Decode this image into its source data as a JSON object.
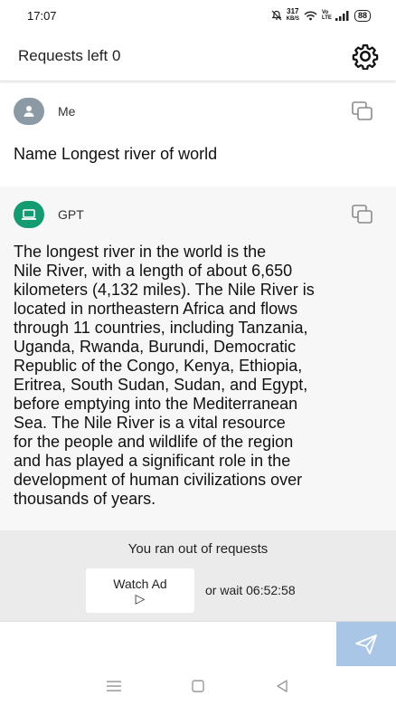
{
  "status_bar": {
    "time": "17:07",
    "speed_value": "317",
    "speed_unit": "KB/S",
    "network_label": "Vo LTE",
    "battery": "88"
  },
  "header": {
    "requests_label": "Requests left 0",
    "settings_icon": "gear-icon"
  },
  "messages": [
    {
      "sender": "Me",
      "avatar_icon": "person-icon",
      "copy_icon": "copy-icon",
      "text": "Name Longest river of world"
    },
    {
      "sender": "GPT",
      "avatar_icon": "laptop-icon",
      "copy_icon": "copy-icon",
      "text": "The longest river in the world is the\nNile River, with a length of about 6,650\nkilometers (4,132 miles). The Nile River is\nlocated in northeastern Africa and flows\nthrough 11 countries, including Tanzania,\nUganda, Rwanda, Burundi, Democratic\nRepublic of the Congo, Kenya, Ethiopia,\nEritrea, South Sudan, Sudan, and Egypt,\nbefore emptying into the Mediterranean\nSea. The Nile River is a vital resource\nfor the people and wildlife of the region\nand has played a significant role in the\ndevelopment of human civilizations over\nthousands of years."
    }
  ],
  "limit_panel": {
    "title": "You ran out of requests",
    "watch_ad_label": "Watch Ad",
    "watch_ad_icon": "▷",
    "wait_text": "or wait 06:52:58"
  },
  "composer": {
    "input_value": "",
    "send_icon": "send-icon"
  },
  "nav": {
    "menu_icon": "menu-icon",
    "home_icon": "square-home-icon",
    "back_icon": "triangle-back-icon"
  },
  "colors": {
    "gpt_avatar": "#159b72",
    "user_avatar": "#8b9aa4",
    "send_button": "#a9c6e6",
    "panel_background": "#ebebeb"
  }
}
